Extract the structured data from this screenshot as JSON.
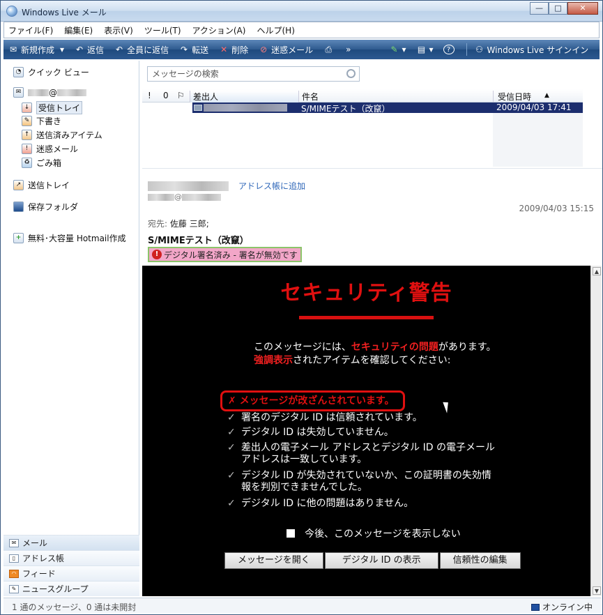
{
  "window": {
    "title": "Windows Live メール",
    "min_label": "—",
    "max_label": "□",
    "close_label": "✕"
  },
  "menu": [
    "ファイル(F)",
    "編集(E)",
    "表示(V)",
    "ツール(T)",
    "アクション(A)",
    "ヘルプ(H)"
  ],
  "toolbar": {
    "new": "新規作成",
    "new_arrow": "▾",
    "reply": "返信",
    "reply_all": "全員に返信",
    "forward": "転送",
    "delete": "削除",
    "junk": "迷惑メール",
    "more": "»",
    "signin": "Windows Live サインイン"
  },
  "sidebar": {
    "quick_views": "クイック ビュー",
    "account_at": "@",
    "folders": [
      "受信トレイ",
      "下書き",
      "送信済みアイテム",
      "迷惑メール",
      "ごみ箱"
    ],
    "outbox": "送信トレイ",
    "storage": "保存フォルダ",
    "hotmail": "無料･大容量 Hotmail作成",
    "nav": [
      "メール",
      "アドレス帳",
      "フィード",
      "ニュースグループ"
    ]
  },
  "search": {
    "placeholder": "メッセージの検索"
  },
  "list": {
    "headers": {
      "importance": "!",
      "attach": "0",
      "flag": "⚐",
      "from": "差出人",
      "subject": "件名",
      "date": "受信日時",
      "sort": "▲"
    },
    "rows": [
      {
        "subject": "S/MIMEテスト（改竄）",
        "date": "2009/04/03 17:41"
      }
    ]
  },
  "preview": {
    "add_contact": "アドレス帳に追加",
    "from_at": "@",
    "date": "2009/04/03 15:15",
    "to_label": "宛先:",
    "to": "佐藤 三郎;",
    "subject": "S/MIMEテスト（改竄）",
    "signature_status": "デジタル署名済み - 署名が無効です"
  },
  "security": {
    "title": "セキュリティ警告",
    "line1_pre": "このメッセージには、",
    "line1_red": "セキュリティの問題",
    "line1_post": "があります。",
    "line2_red": "強調表示",
    "line2_post": "されたアイテムを確認してください:",
    "alert": "メッセージが改ざんされています。",
    "checks": [
      "署名のデジタル ID は信頼されています。",
      "デジタル ID は失効していません。",
      "差出人の電子メール アドレスとデジタル ID の電子メール アドレスは一致しています。",
      "デジタル ID が失効されていないか、この証明書の失効情報を判別できませんでした。",
      "デジタル ID に他の問題はありません。"
    ],
    "dont_show": "今後、このメッセージを表示しない",
    "buttons": [
      "メッセージを開く",
      "デジタル ID の表示",
      "信頼性の編集"
    ]
  },
  "status": {
    "left": "1 通のメッセージ、0 通は未開封",
    "right": "オンライン中"
  },
  "colors": {
    "toolbar_dark": "#1f4a7e",
    "selected_row": "#1c2e6e",
    "warning_red": "#e01010",
    "sig_bar": "#f2a6c8"
  }
}
